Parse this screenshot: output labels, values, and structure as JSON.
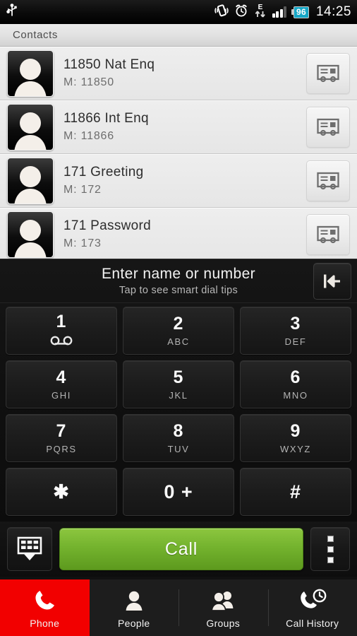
{
  "status_bar": {
    "usb_icon": "usb-icon",
    "vibrate_icon": "vibrate-icon",
    "alarm_icon": "alarm-clock-icon",
    "network_type": "E",
    "data_arrows_icon": "data-transfer-arrows-icon",
    "signal_icon": "signal-bars-icon",
    "signal_bars_filled": 3,
    "signal_bars_total": 4,
    "battery_level": "96",
    "battery_color": "#15a6c6",
    "time": "14:25"
  },
  "contacts_header": {
    "title": "Contacts"
  },
  "contacts": {
    "number_prefix": "M:",
    "card_icon": "contact-card-icon",
    "avatar_icon": "person-placeholder-icon",
    "items": [
      {
        "name": "11850 Nat Enq",
        "number": "M:  11850"
      },
      {
        "name": "11866 Int Enq",
        "number": "M:  11866"
      },
      {
        "name": "171 Greeting",
        "number": "M:  172"
      },
      {
        "name": "171 Password",
        "number": "M:  173"
      }
    ]
  },
  "dialer": {
    "hint_primary": "Enter name or number",
    "hint_secondary": "Tap to see smart dial tips",
    "backspace_icon": "backspace-icon",
    "keys": [
      {
        "digit": "1",
        "letters": "",
        "icon": "voicemail-icon"
      },
      {
        "digit": "2",
        "letters": "ABC",
        "icon": ""
      },
      {
        "digit": "3",
        "letters": "DEF",
        "icon": ""
      },
      {
        "digit": "4",
        "letters": "GHI",
        "icon": ""
      },
      {
        "digit": "5",
        "letters": "JKL",
        "icon": ""
      },
      {
        "digit": "6",
        "letters": "MNO",
        "icon": ""
      },
      {
        "digit": "7",
        "letters": "PQRS",
        "icon": ""
      },
      {
        "digit": "8",
        "letters": "TUV",
        "icon": ""
      },
      {
        "digit": "9",
        "letters": "WXYZ",
        "icon": ""
      },
      {
        "digit": "✱",
        "letters": "",
        "icon": ""
      },
      {
        "digit": "0 +",
        "letters": "",
        "icon": ""
      },
      {
        "digit": "#",
        "letters": "",
        "icon": ""
      }
    ]
  },
  "call_bar": {
    "keypad_toggle_icon": "hide-keypad-icon",
    "call_label": "Call",
    "call_color": "#74b32e",
    "overflow_icon": "overflow-menu-icon"
  },
  "bottom_nav": {
    "active_color": "#f20000",
    "items": [
      {
        "label": "Phone",
        "icon": "phone-handset-icon",
        "active": true
      },
      {
        "label": "People",
        "icon": "person-icon",
        "active": false
      },
      {
        "label": "Groups",
        "icon": "group-people-icon",
        "active": false
      },
      {
        "label": "Call History",
        "icon": "call-history-icon",
        "active": false
      }
    ]
  }
}
